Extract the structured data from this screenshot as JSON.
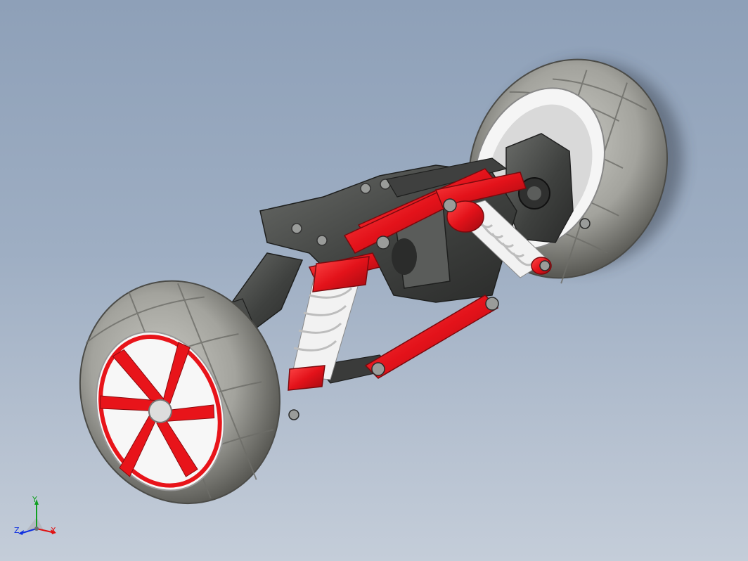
{
  "viewport": {
    "model": "rc-car-rear-suspension-assembly",
    "background_top": "#8ea0b8",
    "background_bottom": "#c4cdd9"
  },
  "colors": {
    "tire": "#a8a8a2",
    "tire_shadow": "#5f5f5a",
    "rim_accent": "#e8141a",
    "rim_face": "#f7f7f7",
    "chassis": "#4a4c4a",
    "spring": "#f0f0f0"
  },
  "triad": {
    "x_label": "X",
    "y_label": "Y",
    "z_label": "Z",
    "x_color": "#e01010",
    "y_color": "#10a020",
    "z_color": "#1030e0"
  }
}
